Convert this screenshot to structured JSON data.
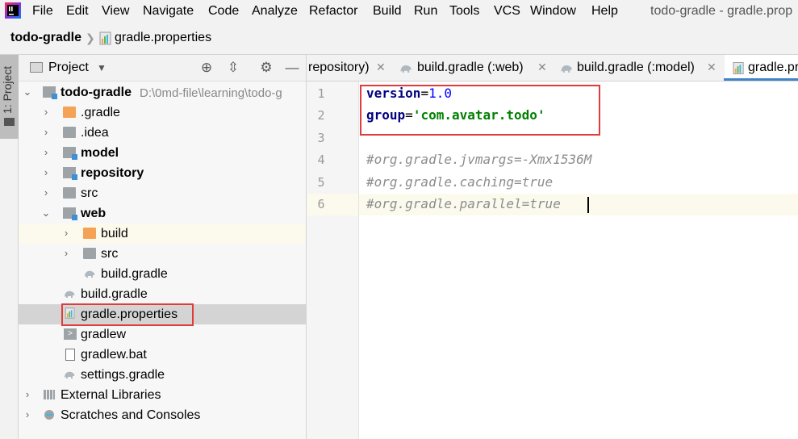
{
  "menubar": {
    "items": [
      "File",
      "Edit",
      "View",
      "Navigate",
      "Code",
      "Analyze",
      "Refactor",
      "Build",
      "Run",
      "Tools",
      "VCS",
      "Window",
      "Help"
    ],
    "window_title": "todo-gradle - gradle.prop"
  },
  "breadcrumb": {
    "project": "todo-gradle",
    "file": "gradle.properties"
  },
  "stripe": {
    "label": "1: Project"
  },
  "project_panel": {
    "title": "Project",
    "tree": [
      {
        "label": "todo-gradle",
        "path": "D:\\0md-file\\learning\\todo-g",
        "icon": "module-folder-icon",
        "bold": true,
        "expanded": true
      },
      {
        "label": ".gradle",
        "icon": "folder-orange-icon",
        "bold": false
      },
      {
        "label": ".idea",
        "icon": "folder-icon",
        "bold": false
      },
      {
        "label": "model",
        "icon": "module-folder-icon",
        "bold": true
      },
      {
        "label": "repository",
        "icon": "module-folder-icon",
        "bold": true
      },
      {
        "label": "src",
        "icon": "folder-icon",
        "bold": false
      },
      {
        "label": "web",
        "icon": "module-folder-icon",
        "bold": true,
        "expanded": true
      },
      {
        "label": "build",
        "icon": "folder-orange-icon",
        "bold": false
      },
      {
        "label": "src",
        "icon": "folder-icon",
        "bold": false
      },
      {
        "label": "build.gradle",
        "icon": "gradle-elephant-icon",
        "bold": false
      },
      {
        "label": "build.gradle",
        "icon": "gradle-elephant-icon",
        "bold": false
      },
      {
        "label": "gradle.properties",
        "icon": "properties-file-icon",
        "bold": false,
        "selected": true
      },
      {
        "label": "gradlew",
        "icon": "shell-script-icon",
        "bold": false
      },
      {
        "label": "gradlew.bat",
        "icon": "text-file-icon",
        "bold": false
      },
      {
        "label": "settings.gradle",
        "icon": "gradle-elephant-icon",
        "bold": false
      },
      {
        "label": "External Libraries",
        "icon": "libraries-icon",
        "bold": false
      },
      {
        "label": "Scratches and Consoles",
        "icon": "scratches-icon",
        "bold": false
      }
    ]
  },
  "tabs": [
    {
      "label": "repository)",
      "icon": null
    },
    {
      "label": "build.gradle (:web)",
      "icon": "gradle-elephant-icon"
    },
    {
      "label": "build.gradle (:model)",
      "icon": "gradle-elephant-icon"
    },
    {
      "label": "gradle.prop",
      "icon": "properties-file-icon",
      "active": true
    }
  ],
  "editor": {
    "line_numbers": [
      "1",
      "2",
      "3",
      "4",
      "5",
      "6"
    ],
    "lines": [
      {
        "key": "version",
        "eq": "=",
        "value": "1.0",
        "kind": "number"
      },
      {
        "key": "group",
        "eq": "=",
        "value": "'com.avatar.todo'",
        "kind": "string"
      },
      {
        "text": "",
        "kind": "blank"
      },
      {
        "text": "#org.gradle.jvmargs=-Xmx1536M",
        "kind": "comment"
      },
      {
        "text": "#org.gradle.caching=true",
        "kind": "comment"
      },
      {
        "text": "#org.gradle.parallel=true",
        "kind": "comment"
      }
    ]
  },
  "colors": {
    "highlight": "#e03c3c",
    "selection": "#d4d4d4",
    "row_highlight": "#fcfaed",
    "active_tab": "#4083c9"
  }
}
